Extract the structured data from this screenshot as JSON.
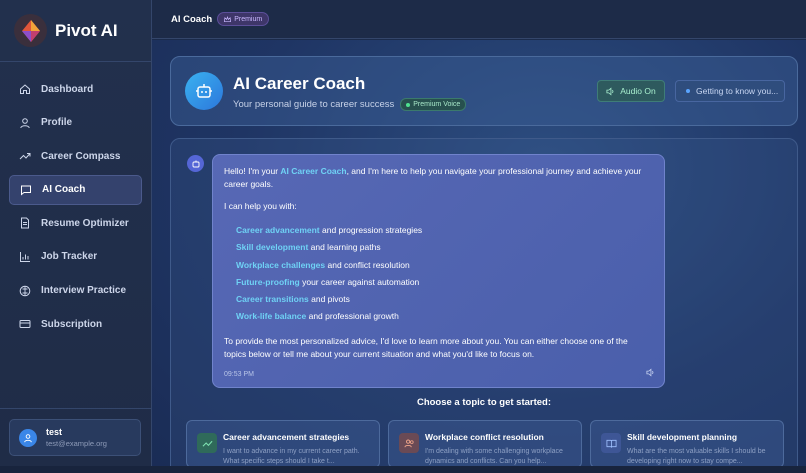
{
  "app": {
    "name": "Pivot AI"
  },
  "sidebar": {
    "items": [
      {
        "label": "Dashboard",
        "icon": "home-icon"
      },
      {
        "label": "Profile",
        "icon": "user-icon"
      },
      {
        "label": "Career Compass",
        "icon": "trend-icon"
      },
      {
        "label": "AI Coach",
        "icon": "chat-icon",
        "active": true
      },
      {
        "label": "Resume Optimizer",
        "icon": "document-icon"
      },
      {
        "label": "Job Tracker",
        "icon": "bar-chart-icon"
      },
      {
        "label": "Interview Practice",
        "icon": "compass-icon"
      },
      {
        "label": "Subscription",
        "icon": "credit-card-icon"
      }
    ],
    "user": {
      "name": "test",
      "email": "test@example.org"
    }
  },
  "topbar": {
    "title": "AI Coach",
    "badge": "Premium"
  },
  "coach": {
    "title": "AI Career Coach",
    "subtitle": "Your personal guide to career success",
    "voice_badge": "Premium Voice",
    "audio_button": "Audio On",
    "status": "Getting to know you..."
  },
  "message": {
    "intro_before": "Hello! I'm your ",
    "intro_highlight": "AI Career Coach",
    "intro_after": ", and I'm here to help you navigate your professional journey and achieve your career goals.",
    "help_lead": "I can help you with:",
    "items": [
      {
        "highlight": "Career advancement",
        "rest": " and progression strategies"
      },
      {
        "highlight": "Skill development",
        "rest": " and learning paths"
      },
      {
        "highlight": "Workplace challenges",
        "rest": " and conflict resolution"
      },
      {
        "highlight": "Future-proofing",
        "rest": " your career against automation"
      },
      {
        "highlight": "Career transitions",
        "rest": " and pivots"
      },
      {
        "highlight": "Work-life balance",
        "rest": " and professional growth"
      }
    ],
    "closing": "To provide the most personalized advice, I'd love to learn more about you. You can either choose one of the topics below or tell me about your current situation and what you'd like to focus on.",
    "time": "09:53 PM"
  },
  "topics": {
    "heading": "Choose a topic to get started:",
    "cards": [
      {
        "title": "Career advancement strategies",
        "desc": "I want to advance in my current career path. What specific steps should I take t...",
        "color": "#3d8a6a"
      },
      {
        "title": "Workplace conflict resolution",
        "desc": "I'm dealing with some challenging workplace dynamics and conflicts. Can you help...",
        "color": "#7a5560"
      },
      {
        "title": "Skill development planning",
        "desc": "What are the most valuable skills I should be developing right now to stay compe...",
        "color": "#4a64a8"
      }
    ]
  }
}
